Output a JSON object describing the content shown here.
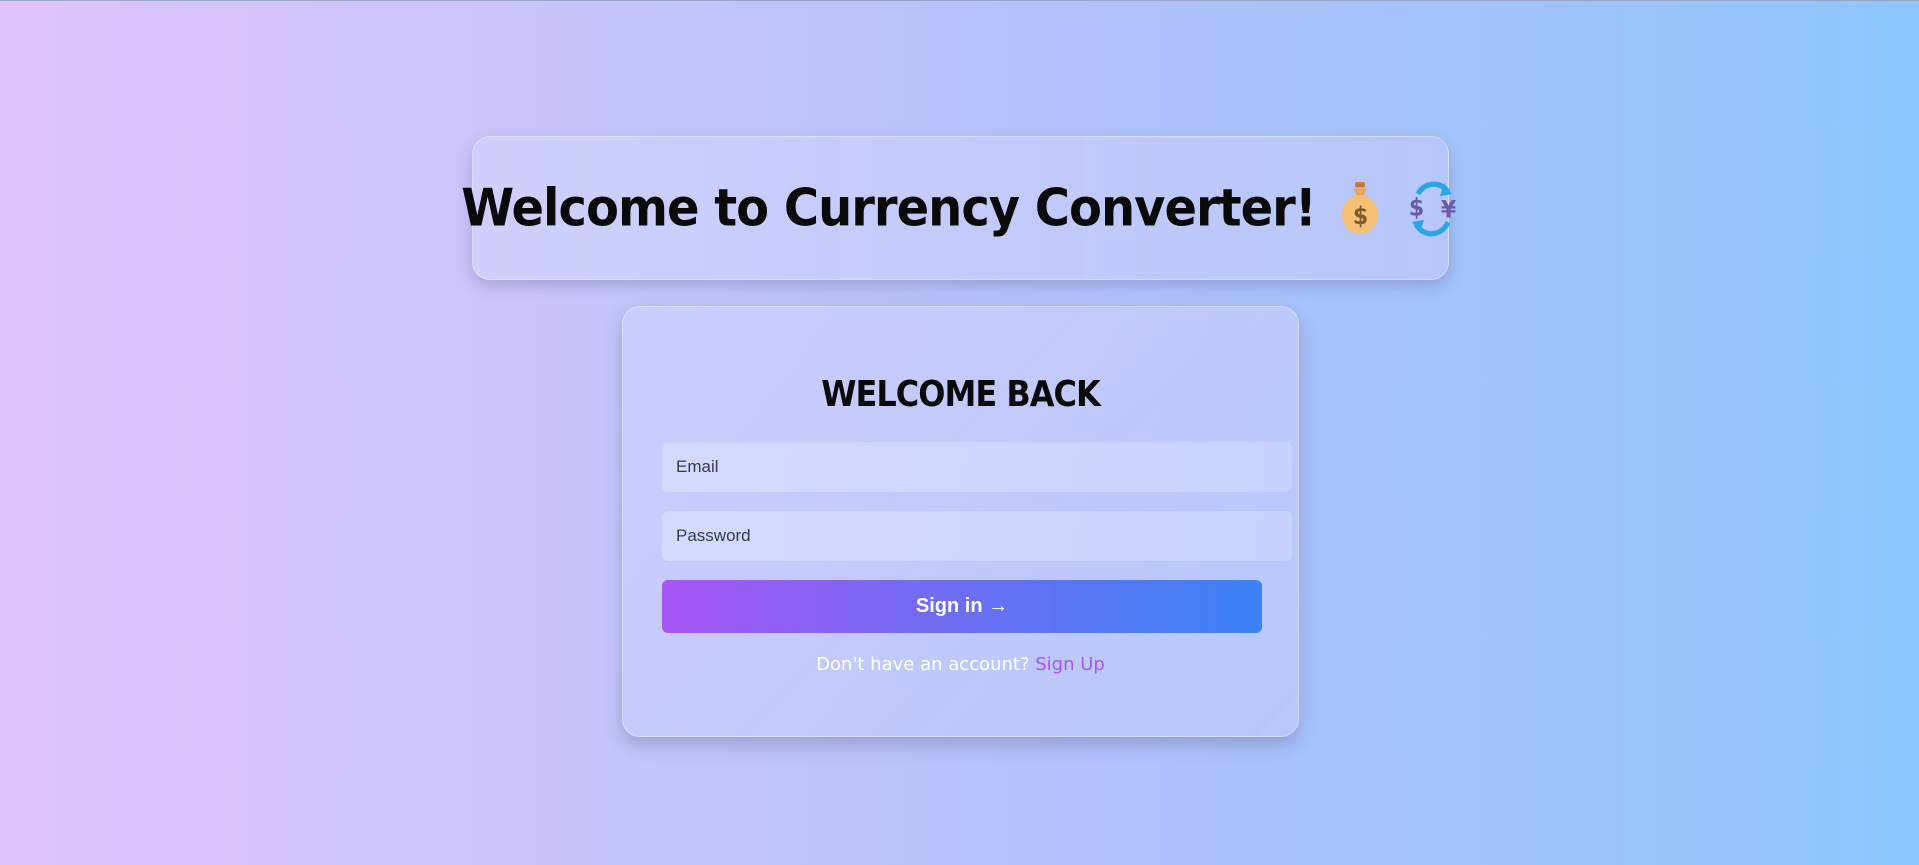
{
  "header": {
    "title": "Welcome to Currency Converter!",
    "icons": [
      "moneybag-icon",
      "currency-exchange-icon"
    ]
  },
  "login": {
    "heading": "WELCOME BACK",
    "email_placeholder": "Email",
    "password_placeholder": "Password",
    "signin_label": "Sign in →",
    "signup_prompt": "Don't have an account?",
    "signup_link": "Sign Up"
  },
  "colors": {
    "button_gradient_start": "#a855f7",
    "button_gradient_end": "#3b82f6",
    "link": "#a855f7",
    "background_left": "#e0c3fc",
    "background_right": "#8ec5fc"
  }
}
